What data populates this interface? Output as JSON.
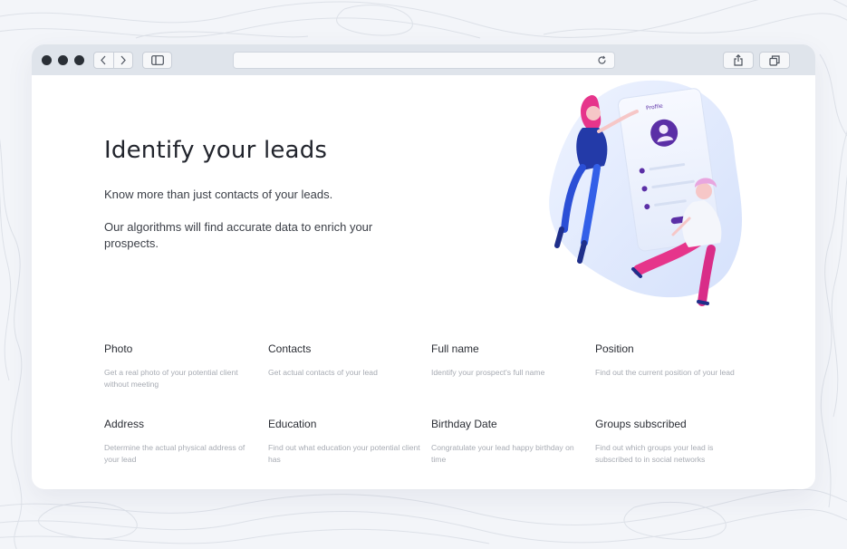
{
  "hero": {
    "title": "Identify your leads",
    "line1": "Know more than just  contacts of your leads.",
    "line2": "Our algorithms will find accurate  data to enrich your prospects."
  },
  "illustration": {
    "card_label": "Profile"
  },
  "features": [
    {
      "title": "Photo",
      "desc": "Get a real photo of your potential client without meeting"
    },
    {
      "title": "Contacts",
      "desc": "Get actual contacts of your lead"
    },
    {
      "title": "Full name",
      "desc": "Identify your prospect's full name"
    },
    {
      "title": "Position",
      "desc": "Find out the current position of your lead"
    },
    {
      "title": "Address",
      "desc": "Determine the actual physical address of your lead"
    },
    {
      "title": "Education",
      "desc": "Find out what education your potential client has"
    },
    {
      "title": "Birthday Date",
      "desc": "Congratulate your lead happy birthday on time"
    },
    {
      "title": "Groups subscribed",
      "desc": "Find out which groups your lead is subscribed to in social networks"
    }
  ],
  "colors": {
    "accent_purple": "#5b2fa6",
    "accent_pink": "#e6358b",
    "accent_blue": "#2b4fd6"
  },
  "icons": [
    "close-dot",
    "minimize-dot",
    "zoom-dot",
    "back-icon",
    "forward-icon",
    "sidebar-icon",
    "reload-icon",
    "share-icon",
    "tabs-icon"
  ]
}
